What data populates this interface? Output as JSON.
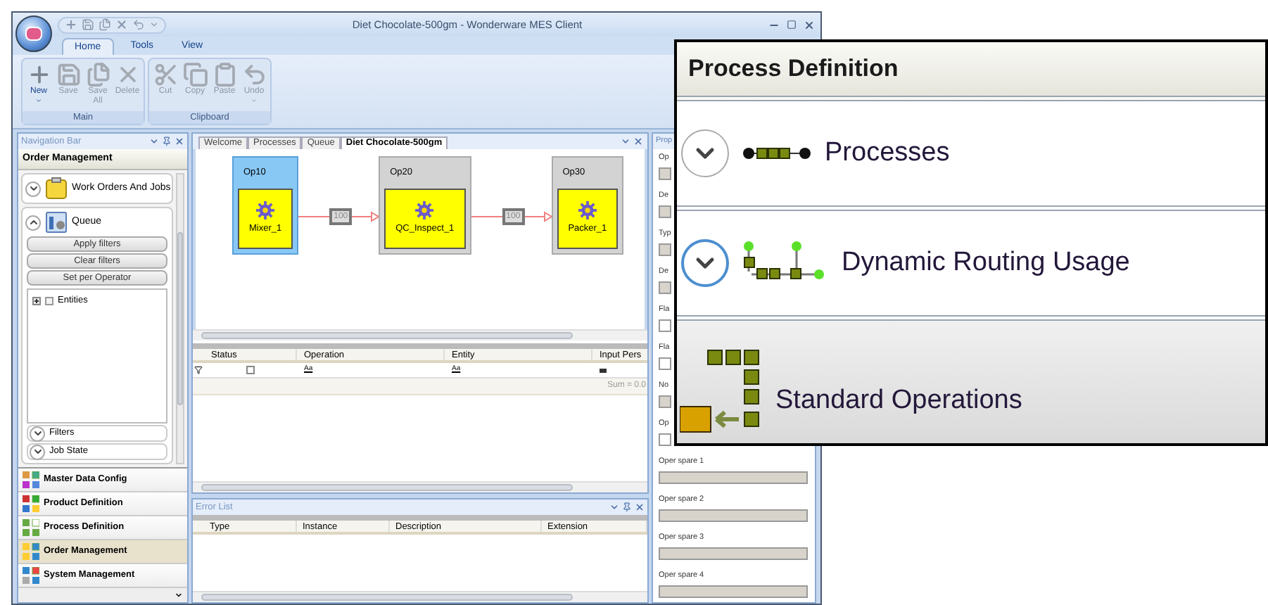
{
  "window": {
    "title": "Diet Chocolate-500gm  -  Wonderware MES Client"
  },
  "ribbon": {
    "tabs": [
      {
        "label": "Home",
        "selected": true
      },
      {
        "label": "Tools",
        "selected": false
      },
      {
        "label": "View",
        "selected": false
      }
    ],
    "groups": [
      {
        "label": "Main",
        "buttons": [
          {
            "label": "New",
            "disabled": false,
            "has_menu": true
          },
          {
            "label": "Save",
            "disabled": true,
            "has_menu": false
          },
          {
            "label": "Save All",
            "disabled": true,
            "has_menu": false
          },
          {
            "label": "Delete",
            "disabled": true,
            "has_menu": false
          }
        ]
      },
      {
        "label": "Clipboard",
        "buttons": [
          {
            "label": "Cut",
            "disabled": true,
            "has_menu": false
          },
          {
            "label": "Copy",
            "disabled": true,
            "has_menu": false
          },
          {
            "label": "Paste",
            "disabled": true,
            "has_menu": false
          },
          {
            "label": "Undo",
            "disabled": true,
            "has_menu": true
          }
        ]
      }
    ]
  },
  "nav_bar": {
    "title": "Navigation Bar",
    "section": "Order Management",
    "items": [
      {
        "label": "Work Orders And Jobs",
        "expanded": false
      },
      {
        "label": "Queue",
        "expanded": true
      }
    ],
    "buttons": [
      "Apply filters",
      "Clear filters",
      "Set per Operator"
    ],
    "tree": [
      {
        "label": "Entities",
        "checked": false
      }
    ],
    "groups": [
      {
        "label": "Filters",
        "expanded": false
      },
      {
        "label": "Job State",
        "expanded": false
      }
    ],
    "modules": [
      {
        "label": "Master Data Config",
        "selected": false
      },
      {
        "label": "Product Definition",
        "selected": false
      },
      {
        "label": "Process Definition",
        "selected": false
      },
      {
        "label": "Order Management",
        "selected": true
      },
      {
        "label": "System Management",
        "selected": false
      }
    ]
  },
  "documents": {
    "tabs": [
      {
        "label": "Welcome",
        "selected": false
      },
      {
        "label": "Processes",
        "selected": false
      },
      {
        "label": "Queue",
        "selected": false
      },
      {
        "label": "Diet Chocolate-500gm",
        "selected": true
      }
    ],
    "operations": [
      {
        "label": "Op10",
        "node": "Mixer_1",
        "selected": true
      },
      {
        "label": "Op20",
        "node": "QC_Inspect_1",
        "selected": false
      },
      {
        "label": "Op30",
        "node": "Packer_1",
        "selected": false
      }
    ],
    "links": [
      "100",
      "100"
    ],
    "grid": {
      "columns": [
        "Status",
        "Operation",
        "Entity",
        "Input Pers"
      ],
      "filter_row": [
        {
          "kind": "checkbox"
        },
        {
          "kind": "operator",
          "label": "Aa"
        },
        {
          "kind": "operator",
          "label": "Aa"
        },
        {
          "kind": "equals"
        }
      ],
      "summary": "Sum = 0.0"
    }
  },
  "error_list": {
    "title": "Error List",
    "columns": [
      "Type",
      "Instance",
      "Description",
      "Extension"
    ]
  },
  "properties": {
    "title": "Prop",
    "fields": [
      {
        "label": "Op",
        "readonly": true
      },
      {
        "label": "De",
        "readonly": true
      },
      {
        "label": "Typ",
        "readonly": true
      },
      {
        "label": "De",
        "readonly": true
      },
      {
        "label": "Fla",
        "readonly": false
      },
      {
        "label": "Fla",
        "readonly": false
      },
      {
        "label": "No",
        "readonly": true
      },
      {
        "label": "Op",
        "readonly": false
      },
      {
        "label": "Oper spare 1",
        "readonly": true
      },
      {
        "label": "Oper spare 2",
        "readonly": true
      },
      {
        "label": "Oper spare 3",
        "readonly": true
      },
      {
        "label": "Oper spare 4",
        "readonly": true
      }
    ]
  },
  "callout": {
    "title": "Process Definition",
    "items": [
      {
        "kind": "chain",
        "label": "Processes",
        "expanded": false,
        "focused": false
      },
      {
        "kind": "routing",
        "label": "Dynamic Routing Usage",
        "expanded": false,
        "focused": true
      }
    ],
    "module": "Standard Operations"
  }
}
